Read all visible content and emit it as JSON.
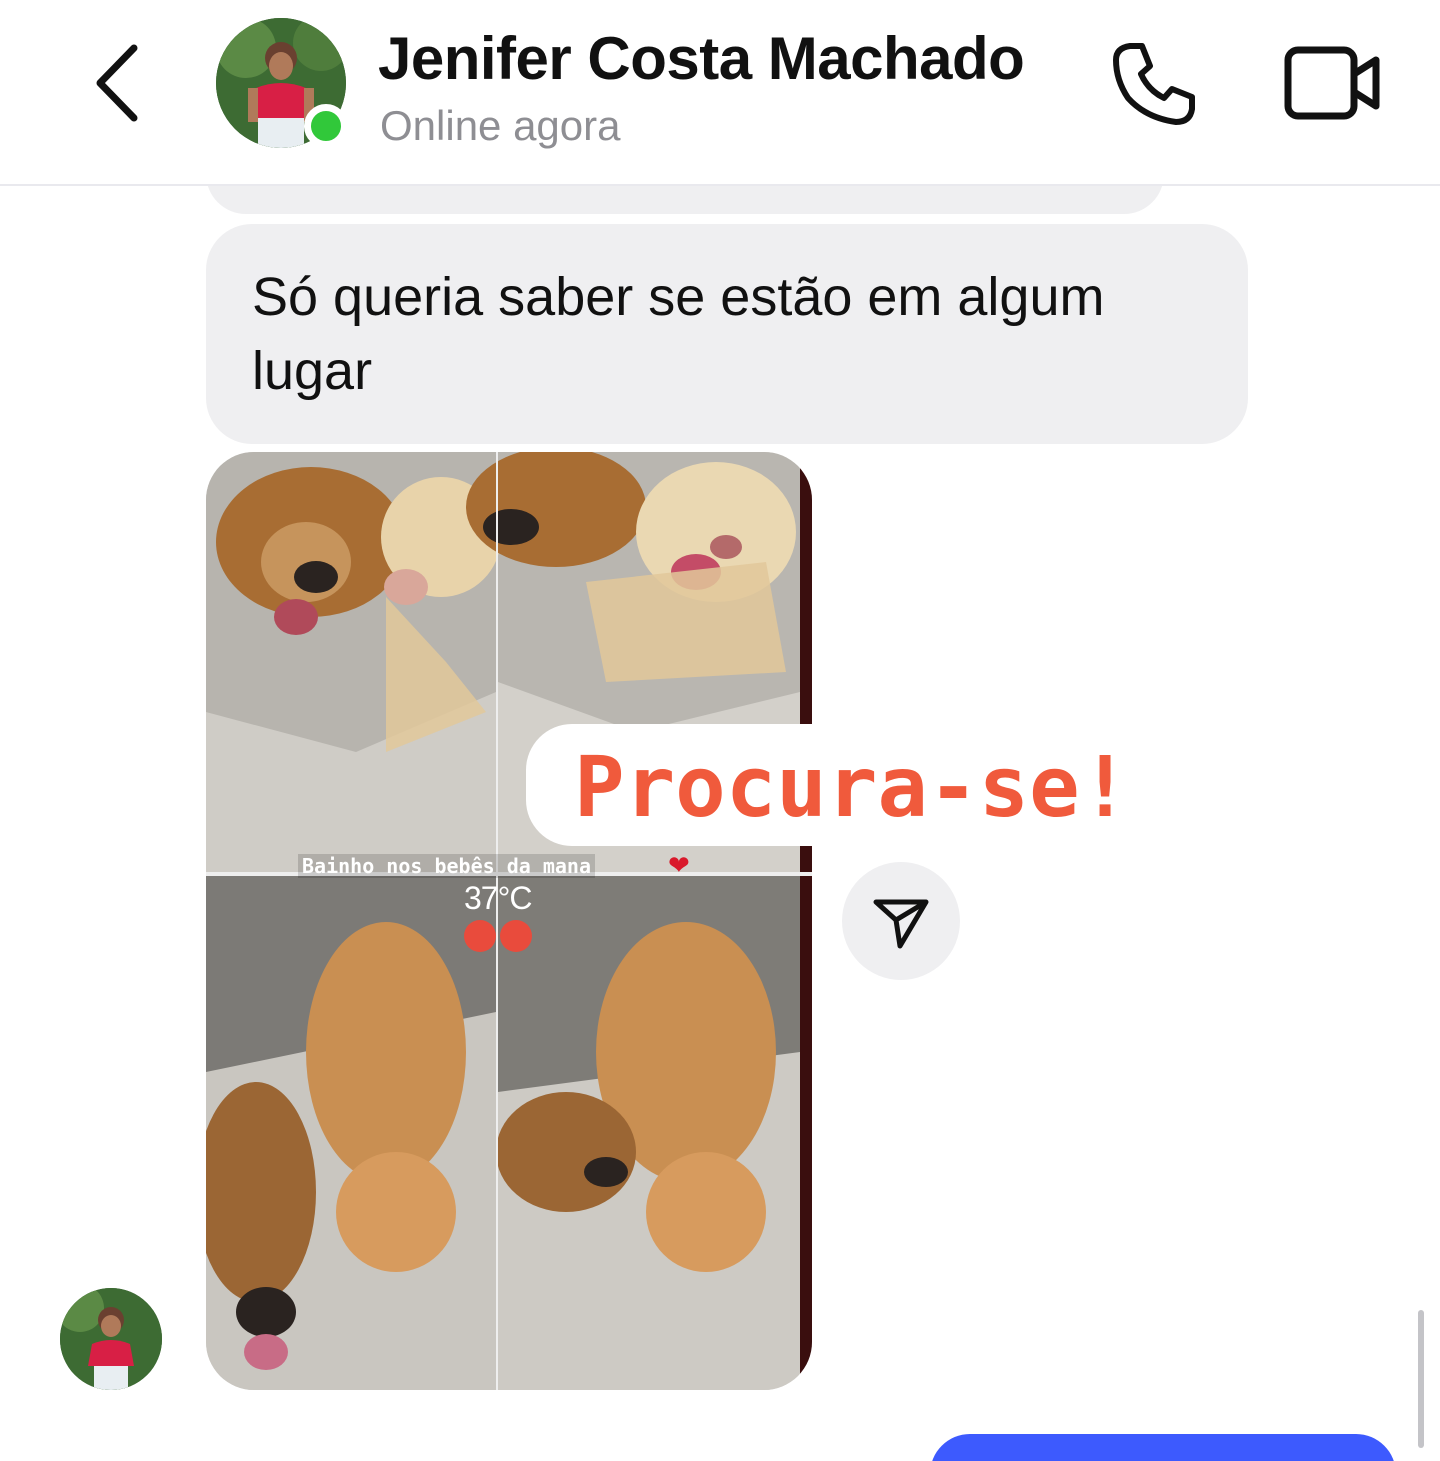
{
  "header": {
    "contact_name": "Jenifer Costa Machado",
    "status": "Online agora",
    "online_color": "#31c83a",
    "icons": {
      "back": "chevron-left-icon",
      "call": "phone-icon",
      "video": "video-camera-icon"
    }
  },
  "messages": [
    {
      "type": "text",
      "direction": "received",
      "text": "Só queria saber se estão em algum lugar"
    },
    {
      "type": "shared-story",
      "direction": "received",
      "caption_sticker": "Procura-se!",
      "story_text": "Bainho nos bebês da mana",
      "heart": "❤",
      "temperature": "37°C"
    }
  ],
  "colors": {
    "bubble_received": "#efeff1",
    "bubble_sent": "#3d5afe",
    "sticker_text": "#f05a3c"
  }
}
